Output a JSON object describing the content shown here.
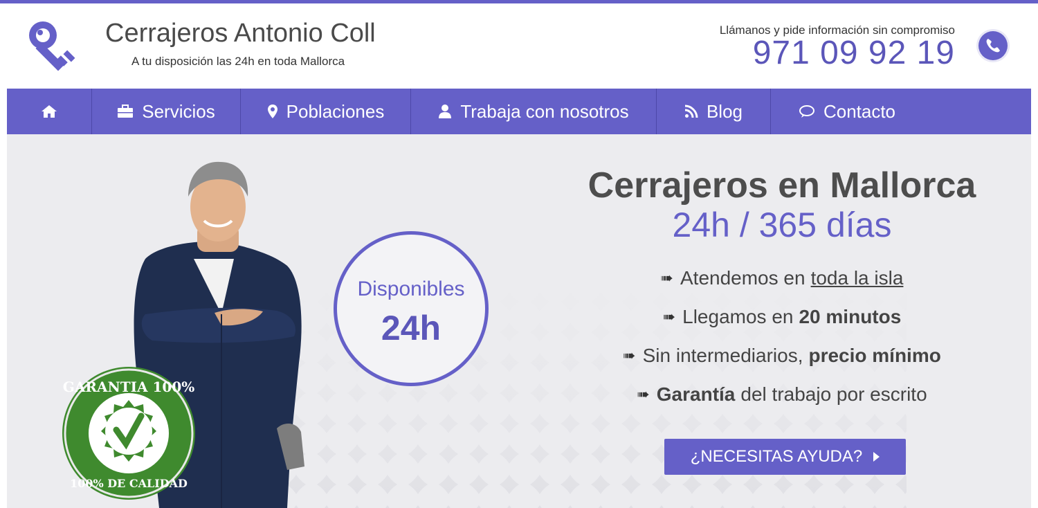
{
  "header": {
    "brand_title": "Cerrajeros Antonio Coll",
    "brand_subtitle": "A tu disposición las 24h en toda Mallorca",
    "call_text": "Llámanos y pide información sin compromiso",
    "phone": "971 09 92 19",
    "logo_icon": "key-icon",
    "phone_icon": "phone-icon"
  },
  "nav": {
    "items": [
      {
        "label": "",
        "icon": "home-icon"
      },
      {
        "label": "Servicios",
        "icon": "briefcase-icon"
      },
      {
        "label": "Poblaciones",
        "icon": "map-marker-icon"
      },
      {
        "label": "Trabaja con nosotros",
        "icon": "user-icon"
      },
      {
        "label": "Blog",
        "icon": "rss-icon"
      },
      {
        "label": "Contacto",
        "icon": "chat-bubble-icon"
      }
    ]
  },
  "hero": {
    "title": "Cerrajeros en Mallorca",
    "subtitle": "24h / 365 días",
    "badge_label": "Disponibles",
    "badge_hours": "24h",
    "seal_text_top": "GARANTIA 100%",
    "seal_text_bottom": "100% DE CALIDAD",
    "bullets": [
      {
        "before": "Atendemos en",
        "link": "toda la isla"
      },
      {
        "before": "Llegamos en",
        "bold": "20 minutos"
      },
      {
        "before": "Sin intermediarios,",
        "bold": "precio mínimo"
      },
      {
        "bold_first": "Garantía",
        "after": "del trabajo por escrito"
      }
    ],
    "cta_label": "¿NECESITAS AYUDA?"
  },
  "colors": {
    "accent": "#6560c8",
    "accent_dark": "#5b56b9",
    "hero_bg": "#ececef",
    "text_dark": "#4d4d4d",
    "seal_green": "#3f8a2e"
  }
}
